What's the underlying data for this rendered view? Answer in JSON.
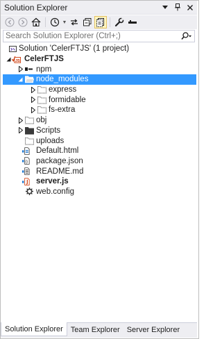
{
  "window": {
    "title": "Solution Explorer"
  },
  "toolbar": {
    "buttons": [
      "back-icon",
      "forward-icon",
      "home-icon",
      "sync-history-icon",
      "refresh-icon",
      "collapse-all-icon",
      "show-all-files-icon",
      "properties-icon",
      "preview-icon"
    ]
  },
  "search": {
    "placeholder": "Search Solution Explorer (Ctrl+;)"
  },
  "tree": {
    "solution": "Solution 'CelerFTJS' (1 project)",
    "project": "CelerFTJS",
    "npm": "npm",
    "node_modules": "node_modules",
    "express": "express",
    "formidable": "formidable",
    "fs_extra": "fs-extra",
    "obj": "obj",
    "scripts": "Scripts",
    "uploads": "uploads",
    "default_html": "Default.html",
    "package_json": "package.json",
    "readme": "README.md",
    "server_js": "server.js",
    "web_config": "web.config"
  },
  "tabs": {
    "solution_explorer": "Solution Explorer",
    "team_explorer": "Team Explorer",
    "server_explorer": "Server Explorer"
  },
  "colors": {
    "selection": "#3399ff",
    "chrome": "#eeeef2",
    "js_red": "#cc3300",
    "folder_yellow": "#dcb67a"
  }
}
